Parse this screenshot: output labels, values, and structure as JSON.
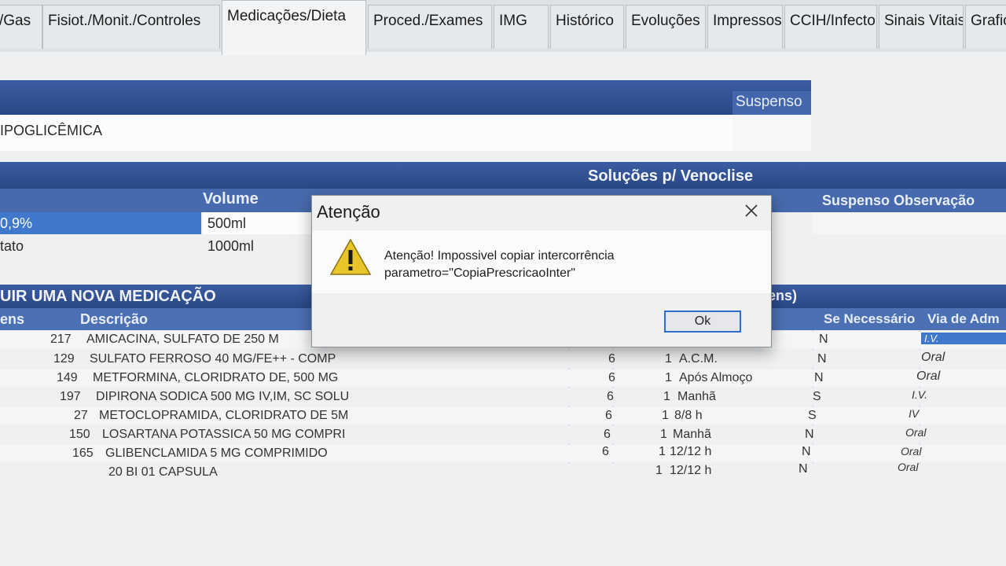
{
  "tabs": [
    {
      "label": "/Gas"
    },
    {
      "label": "Fisiot./Monit./Controles"
    },
    {
      "label": "Medicações/Dieta",
      "active": true
    },
    {
      "label": "Proced./Exames"
    },
    {
      "label": "IMG"
    },
    {
      "label": "Histórico"
    },
    {
      "label": "Evoluções"
    },
    {
      "label": "Impressos"
    },
    {
      "label": "CCIH/Infecto"
    },
    {
      "label": "Sinais Vitais"
    },
    {
      "label": "Grafico"
    }
  ],
  "section1": {
    "suspenso_header": "Suspenso",
    "diet_text": "IPOGLICÊMICA"
  },
  "solucoes": {
    "title": "Soluções p/ Venoclise",
    "volume_header": "Volume",
    "suspenso_obs_header": "Suspenso Observação",
    "rows": [
      {
        "name": "0,9%",
        "volume": "500ml"
      },
      {
        "name": "tato",
        "volume": "1000ml"
      }
    ]
  },
  "medicacoes": {
    "title": "UIR UMA NOVA MEDICAÇÃO",
    "items_header": "itens)",
    "col_itens": "ens",
    "col_descricao": "Descrição",
    "col_se_necessario": "Se Necessário",
    "col_via": "Via  de Adm",
    "rows": [
      {
        "code": "217",
        "desc": "AMICACINA, SULFATO DE 250 M",
        "qty": "",
        "dose": "",
        "freq": "",
        "sn": "N",
        "via": "I.V."
      },
      {
        "code": "129",
        "desc": "SULFATO FERROSO 40 MG/FE++ - COMP",
        "qty": "6",
        "dose": "1",
        "freq": "A.C.M.",
        "sn": "N",
        "via": "Oral"
      },
      {
        "code": "149",
        "desc": "METFORMINA, CLORIDRATO DE, 500 MG",
        "qty": "6",
        "dose": "1",
        "freq": "Após Almoço",
        "sn": "N",
        "via": "Oral"
      },
      {
        "code": "197",
        "desc": "DIPIRONA SODICA 500 MG IV,IM, SC SOLU",
        "qty": "6",
        "dose": "1",
        "freq": "Manhã",
        "sn": "S",
        "via": "I.V."
      },
      {
        "code": "27",
        "desc": "METOCLOPRAMIDA, CLORIDRATO DE 5M",
        "qty": "6",
        "dose": "1",
        "freq": "8/8 h",
        "sn": "S",
        "via": "IV"
      },
      {
        "code": "150",
        "desc": "LOSARTANA POTASSICA  50 MG COMPRI",
        "qty": "6",
        "dose": "1",
        "freq": "Manhã",
        "sn": "N",
        "via": "Oral"
      },
      {
        "code": "165",
        "desc": "GLIBENCLAMIDA 5 MG COMPRIMIDO",
        "qty": "6",
        "dose": "1",
        "freq": "12/12 h",
        "sn": "N",
        "via": "Oral"
      },
      {
        "code": "",
        "desc": "20 BI 01 CAPSULA",
        "qty": "",
        "dose": "1",
        "freq": "12/12 h",
        "sn": "N",
        "via": "Oral"
      }
    ]
  },
  "dialog": {
    "title": "Atenção",
    "message_line1": "Atenção! Impossivel copiar intercorrência",
    "message_line2": "parametro=\"CopiaPrescricaoInter\"",
    "ok_label": "Ok",
    "icon": "warning-icon",
    "close_icon": "close-icon"
  }
}
